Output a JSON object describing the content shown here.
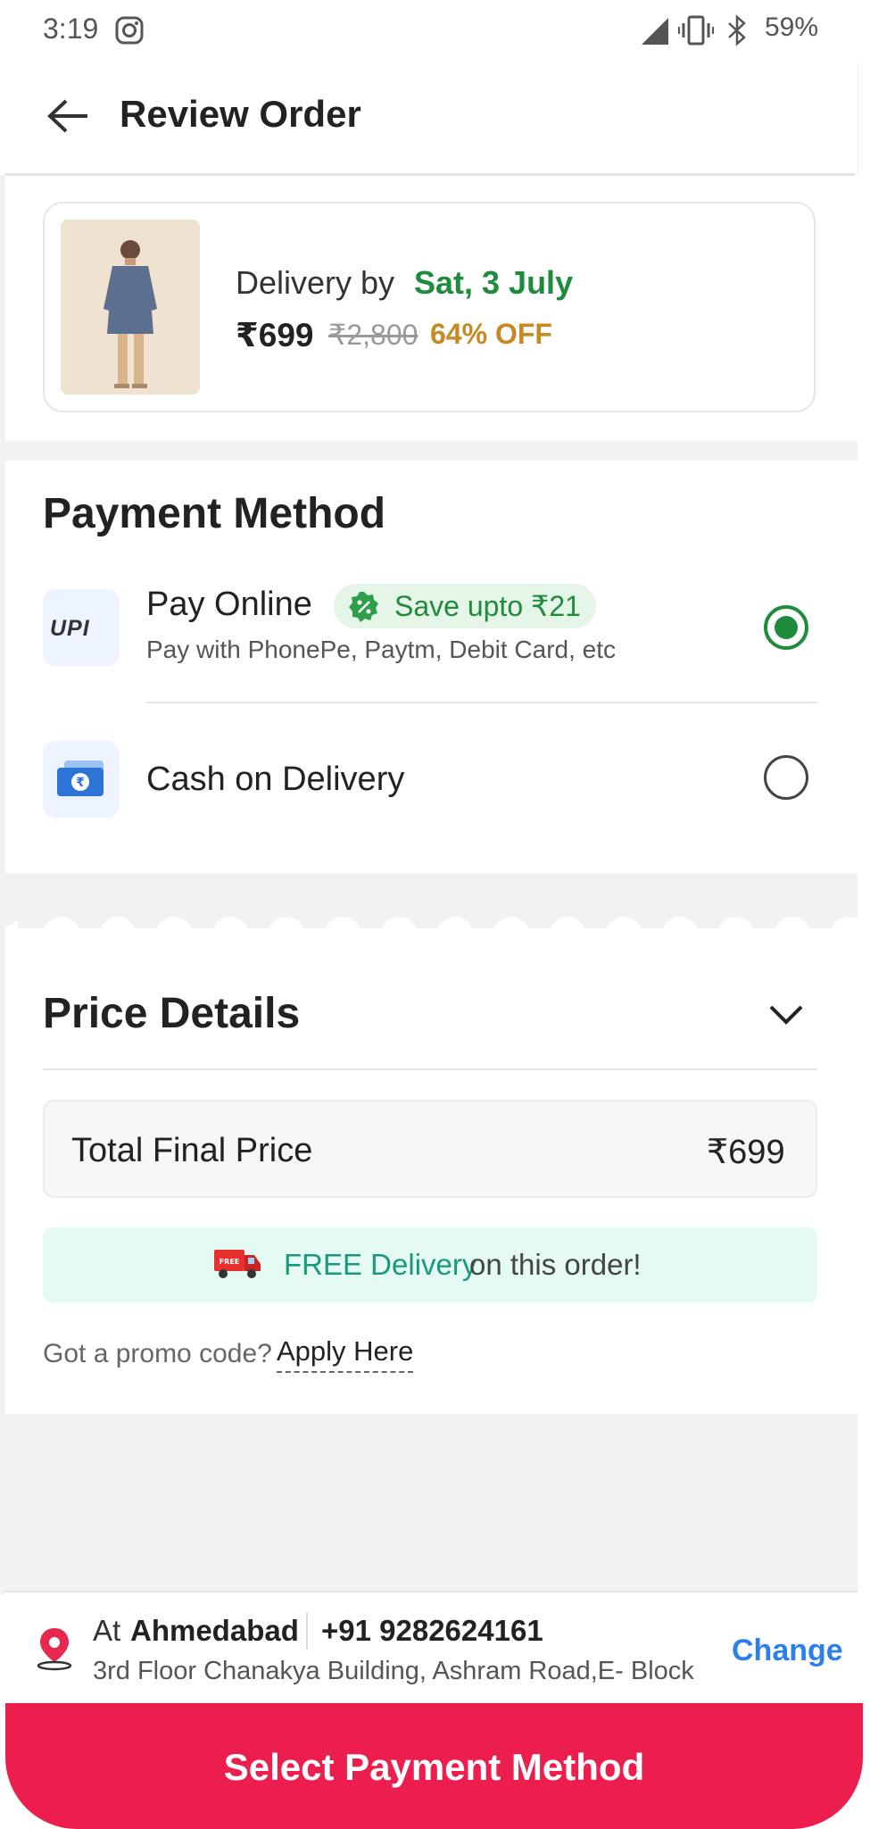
{
  "status_bar": {
    "time": "3:19",
    "battery": "59%",
    "icons": [
      "instagram-icon",
      "signal-icon",
      "vibrate-icon",
      "bluetooth-icon"
    ]
  },
  "header": {
    "title": "Review Order",
    "back_icon": "arrow-left-icon"
  },
  "product": {
    "delivery_label": "Delivery by",
    "delivery_date": "Sat, 3 July",
    "price": "₹699",
    "mrp": "₹2,800",
    "discount": "64% OFF"
  },
  "payment": {
    "title": "Payment Method",
    "online": {
      "logo_text": "UPI",
      "label": "Pay Online",
      "badge": "Save upto ₹21",
      "subtitle": "Pay with PhonePe, Paytm, Debit Card, etc",
      "selected": true
    },
    "cod": {
      "label": "Cash on Delivery",
      "selected": false
    }
  },
  "price_details": {
    "title": "Price Details",
    "total_label": "Total Final Price",
    "total_value": "₹699",
    "free_delivery_highlight": "FREE Delivery",
    "free_delivery_rest": "on this order!",
    "promo_question": "Got a promo code?",
    "promo_link": "Apply Here"
  },
  "address": {
    "prefix": "At",
    "city": "Ahmedabad",
    "phone": "+91 9282624161",
    "line": "3rd Floor Chanakya Building, Ashram Road,E- Block",
    "change": "Change"
  },
  "cta": {
    "label": "Select Payment Method"
  },
  "colors": {
    "primary_cta": "#ec1e4e",
    "success_green": "#1f8b3d",
    "discount_gold": "#c58a23",
    "link_blue": "#2d7ff0",
    "free_delivery_bg": "#e4faf3"
  }
}
